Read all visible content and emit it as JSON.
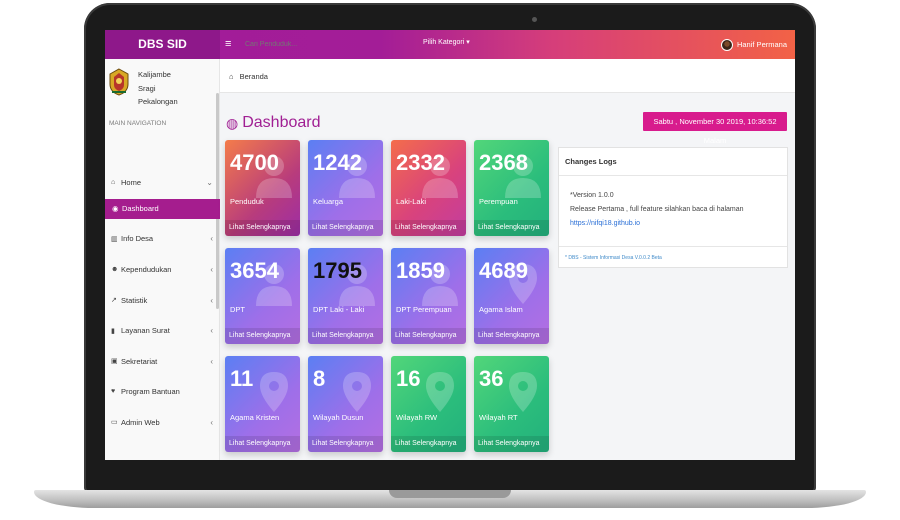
{
  "topbar": {
    "brand": "DBS SID",
    "menu_icon": "hamburger-icon",
    "search_placeholder": "Cari Penduduk...",
    "category_label": "Pilih Kategori ▾",
    "user_name": "Hanif Permana"
  },
  "sidebar": {
    "org_lines": [
      "Kalijambe",
      "Sragi",
      "Pekalongan"
    ],
    "section_label": "MAIN NAVIGATION",
    "items": [
      {
        "label": "Home",
        "icon": "home-icon",
        "chevron": "⌄"
      },
      {
        "label": "Dashboard",
        "icon": "dashboard-icon",
        "active": true
      },
      {
        "label": "Info Desa",
        "icon": "bank-icon",
        "chevron": "‹"
      },
      {
        "label": "Kependudukan",
        "icon": "users-icon",
        "chevron": "‹"
      },
      {
        "label": "Statistik",
        "icon": "chart-icon",
        "chevron": "‹"
      },
      {
        "label": "Layanan Surat",
        "icon": "book-icon",
        "chevron": "‹"
      },
      {
        "label": "Sekretariat",
        "icon": "archive-icon",
        "chevron": "‹"
      },
      {
        "label": "Program Bantuan",
        "icon": "heart-icon",
        "chevron": ""
      },
      {
        "label": "Admin Web",
        "icon": "desktop-icon",
        "chevron": "‹"
      }
    ]
  },
  "content": {
    "breadcrumb": "Beranda",
    "title": "Dashboard",
    "date": "Sabtu , November 30 2019, 10:36:52 Malam",
    "cards": [
      {
        "value": "4700",
        "label": "Penduduk",
        "footer": "Lihat Selengkapnya",
        "icon": "person-icon",
        "color": "orange"
      },
      {
        "value": "1242",
        "label": "Keluarga",
        "footer": "Lihat Selengkapnya",
        "icon": "person-icon",
        "color": "blue"
      },
      {
        "value": "2332",
        "label": "Laki-Laki",
        "footer": "Lihat Selengkapnya",
        "icon": "person-icon",
        "color": "pink"
      },
      {
        "value": "2368",
        "label": "Perempuan",
        "footer": "Lihat Selengkapnya",
        "icon": "person-icon",
        "color": "green"
      },
      {
        "value": "3654",
        "label": "DPT",
        "footer": "Lihat Selengkapnya",
        "icon": "person-icon",
        "color": "blue"
      },
      {
        "value": "1795",
        "label": "DPT Laki - Laki",
        "footer": "Lihat Selengkapnya",
        "icon": "person-icon",
        "color": "blue"
      },
      {
        "value": "1859",
        "label": "DPT Perempuan",
        "footer": "Lihat Selengkapnya",
        "icon": "person-icon",
        "color": "blue"
      },
      {
        "value": "4689",
        "label": "Agama Islam",
        "footer": "Lihat Selengkapnya",
        "icon": "map-marker-icon",
        "color": "blue"
      },
      {
        "value": "11",
        "label": "Agama Kristen",
        "footer": "Lihat Selengkapnya",
        "icon": "map-marker-icon",
        "color": "blue"
      },
      {
        "value": "8",
        "label": "Wilayah Dusun",
        "footer": "Lihat Selengkapnya",
        "icon": "map-marker-icon",
        "color": "blue"
      },
      {
        "value": "16",
        "label": "Wilayah RW",
        "footer": "Lihat Selengkapnya",
        "icon": "map-marker-icon",
        "color": "green"
      },
      {
        "value": "36",
        "label": "Wilayah RT",
        "footer": "Lihat Selengkapnya",
        "icon": "map-marker-icon",
        "color": "green"
      }
    ],
    "changes": {
      "title": "Changes Logs",
      "version": "*Version 1.0.0",
      "text": "Release Pertama , full feature silahkan baca di halaman",
      "link": "https://nifqi18.github.io",
      "footer": "* DBS - Sistem Informasi Desa V.0.0.2 Beta"
    }
  }
}
